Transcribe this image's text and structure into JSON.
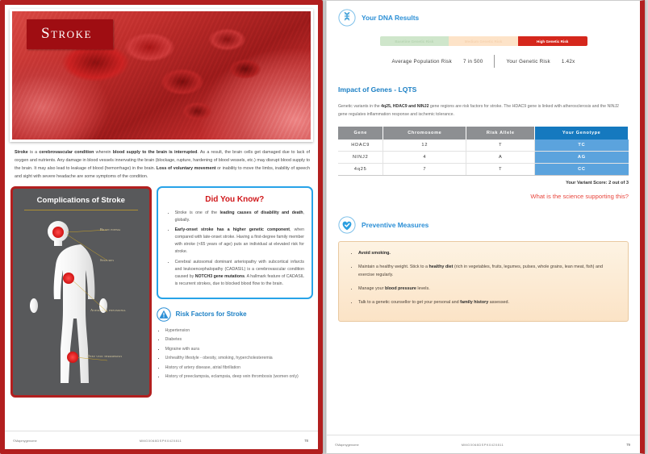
{
  "left_page": {
    "hero_title": "Stroke",
    "intro_parts": [
      {
        "t": "Stroke",
        "b": true
      },
      {
        "t": " is a ",
        "b": false
      },
      {
        "t": "cerebrovascular condition",
        "b": true
      },
      {
        "t": " wherein ",
        "b": false
      },
      {
        "t": "blood supply to the brain is interrupted",
        "b": true
      },
      {
        "t": ". As a result, the brain cells get damaged due to lack of oxygen and nutrients. Any damage in blood vessels innervating the brain (blockage, rupture, hardening of blood vessels, etc.) may disrupt blood supply to the brain. It may also lead to leakage of blood (hemorrhage) in the brain. ",
        "b": false
      },
      {
        "t": "Loss of voluntary movement",
        "b": true
      },
      {
        "t": " or inability to move the limbs, inability of speech and sight with severe headache are some symptoms of the condition.",
        "b": false
      }
    ],
    "complications": {
      "title": "Complications of Stroke",
      "labels": [
        "Brain edema",
        "Seizures",
        "Aspiration pneumonia",
        "Deep vein thrombosis"
      ]
    },
    "did_you_know": {
      "title": "Did You Know?",
      "bullets": [
        [
          {
            "t": "Stroke is one of the ",
            "b": false
          },
          {
            "t": "leading causes of disability and death",
            "b": true
          },
          {
            "t": ", globally.",
            "b": false
          }
        ],
        [
          {
            "t": "Early-onset stroke has a higher genetic component",
            "b": true
          },
          {
            "t": ", when compared with late-onset stroke. Having a first-degree family member with stroke (<65 years of age) puts an individual at elevated risk for stroke.",
            "b": false
          }
        ],
        [
          {
            "t": "Cerebral autosomal dominant arteriopathy with subcortical infarcts and leukoencephalopathy (CADASIL) is a cerebrovascular condition caused by ",
            "b": false
          },
          {
            "t": "NOTCH3 gene mutations",
            "b": true
          },
          {
            "t": ". A hallmark feature of CADASIL is recurrent strokes, due to blocked blood flow to the brain.",
            "b": false
          }
        ]
      ]
    },
    "risk_factors": {
      "title": "Risk Factors for Stroke",
      "icon": "warning-triangle-icon",
      "items": [
        "Hypertension",
        "Diabetes",
        "Migraine with aura",
        "Unhealthy lifestyle - obesity, smoking, hypercholesteremia",
        "History of artery disease, atrial fibrillation",
        "History of preeclampsia, eclampsia, deep vein thrombosis (women only)"
      ]
    },
    "footer": {
      "copyright": "©Mapmygenome",
      "code": "MMG0068DSPK0420811",
      "page": "78"
    }
  },
  "right_page": {
    "dna_results": {
      "icon": "dna-icon",
      "title": "Your DNA Results",
      "risk_segments": [
        "Baseline Genetic Risk",
        "Medium Genetic Risk",
        "High Genetic Risk"
      ],
      "active_segment": "High Genetic Risk",
      "avg_label": "Average Population Risk",
      "avg_value": "7 in 500",
      "your_label": "Your Genetic Risk",
      "your_value": "1.42x"
    },
    "genes": {
      "title": "Impact of Genes - LQTS",
      "text_parts": [
        {
          "t": "Genetic variants in the ",
          "b": false
        },
        {
          "t": "4q25, HDAC9 and NINJ2",
          "b": true
        },
        {
          "t": " gene regions are risk factors for stroke. The HDAC9 gene is linked with atherosclerosis and the NINJ2 gene regulates inflammation response and ischemic tolerance.",
          "b": false
        }
      ],
      "table": {
        "headers": [
          "Gene",
          "Chromosome",
          "Risk Allele",
          "Your Genotype"
        ],
        "rows": [
          [
            "HDAC9",
            "12",
            "T",
            "TC"
          ],
          [
            "NINJ2",
            "4",
            "A",
            "AG"
          ],
          [
            "4q25",
            "7",
            "T",
            "CC"
          ]
        ]
      },
      "variant_score": "Your Variant Score: 2 out of 3",
      "science_link": "What is the science supporting this?"
    },
    "preventive": {
      "icon": "heart-check-icon",
      "title": "Preventive Measures",
      "bullets": [
        [
          {
            "t": "Avoid smoking.",
            "b": true
          }
        ],
        [
          {
            "t": "Maintain a healthy weight. Stick to a ",
            "b": false
          },
          {
            "t": "healthy diet",
            "b": true
          },
          {
            "t": " (rich in vegetables, fruits, legumes, pulses, whole grains, lean meat, fish) and exercise regularly.",
            "b": false
          }
        ],
        [
          {
            "t": "Manage your ",
            "b": false
          },
          {
            "t": "blood pressure",
            "b": true
          },
          {
            "t": " levels.",
            "b": false
          }
        ],
        [
          {
            "t": "Talk to a genetic counsellor to get your personal and ",
            "b": false
          },
          {
            "t": "family history",
            "b": true
          },
          {
            "t": " assessed.",
            "b": false
          }
        ]
      ]
    },
    "footer": {
      "copyright": "©Mapmygenome",
      "code": "MMG0068DSPK0420811",
      "page": "79"
    }
  },
  "colors": {
    "brand_red": "#b21f1f",
    "title_red": "#9f0d12",
    "blue": "#2b8fd6",
    "table_header_gray": "#8d8f92",
    "table_header_blue": "#1579bf",
    "genotype_blue": "#5ba3dd",
    "high_risk_red": "#d5271c",
    "link_red": "#e8453c"
  }
}
